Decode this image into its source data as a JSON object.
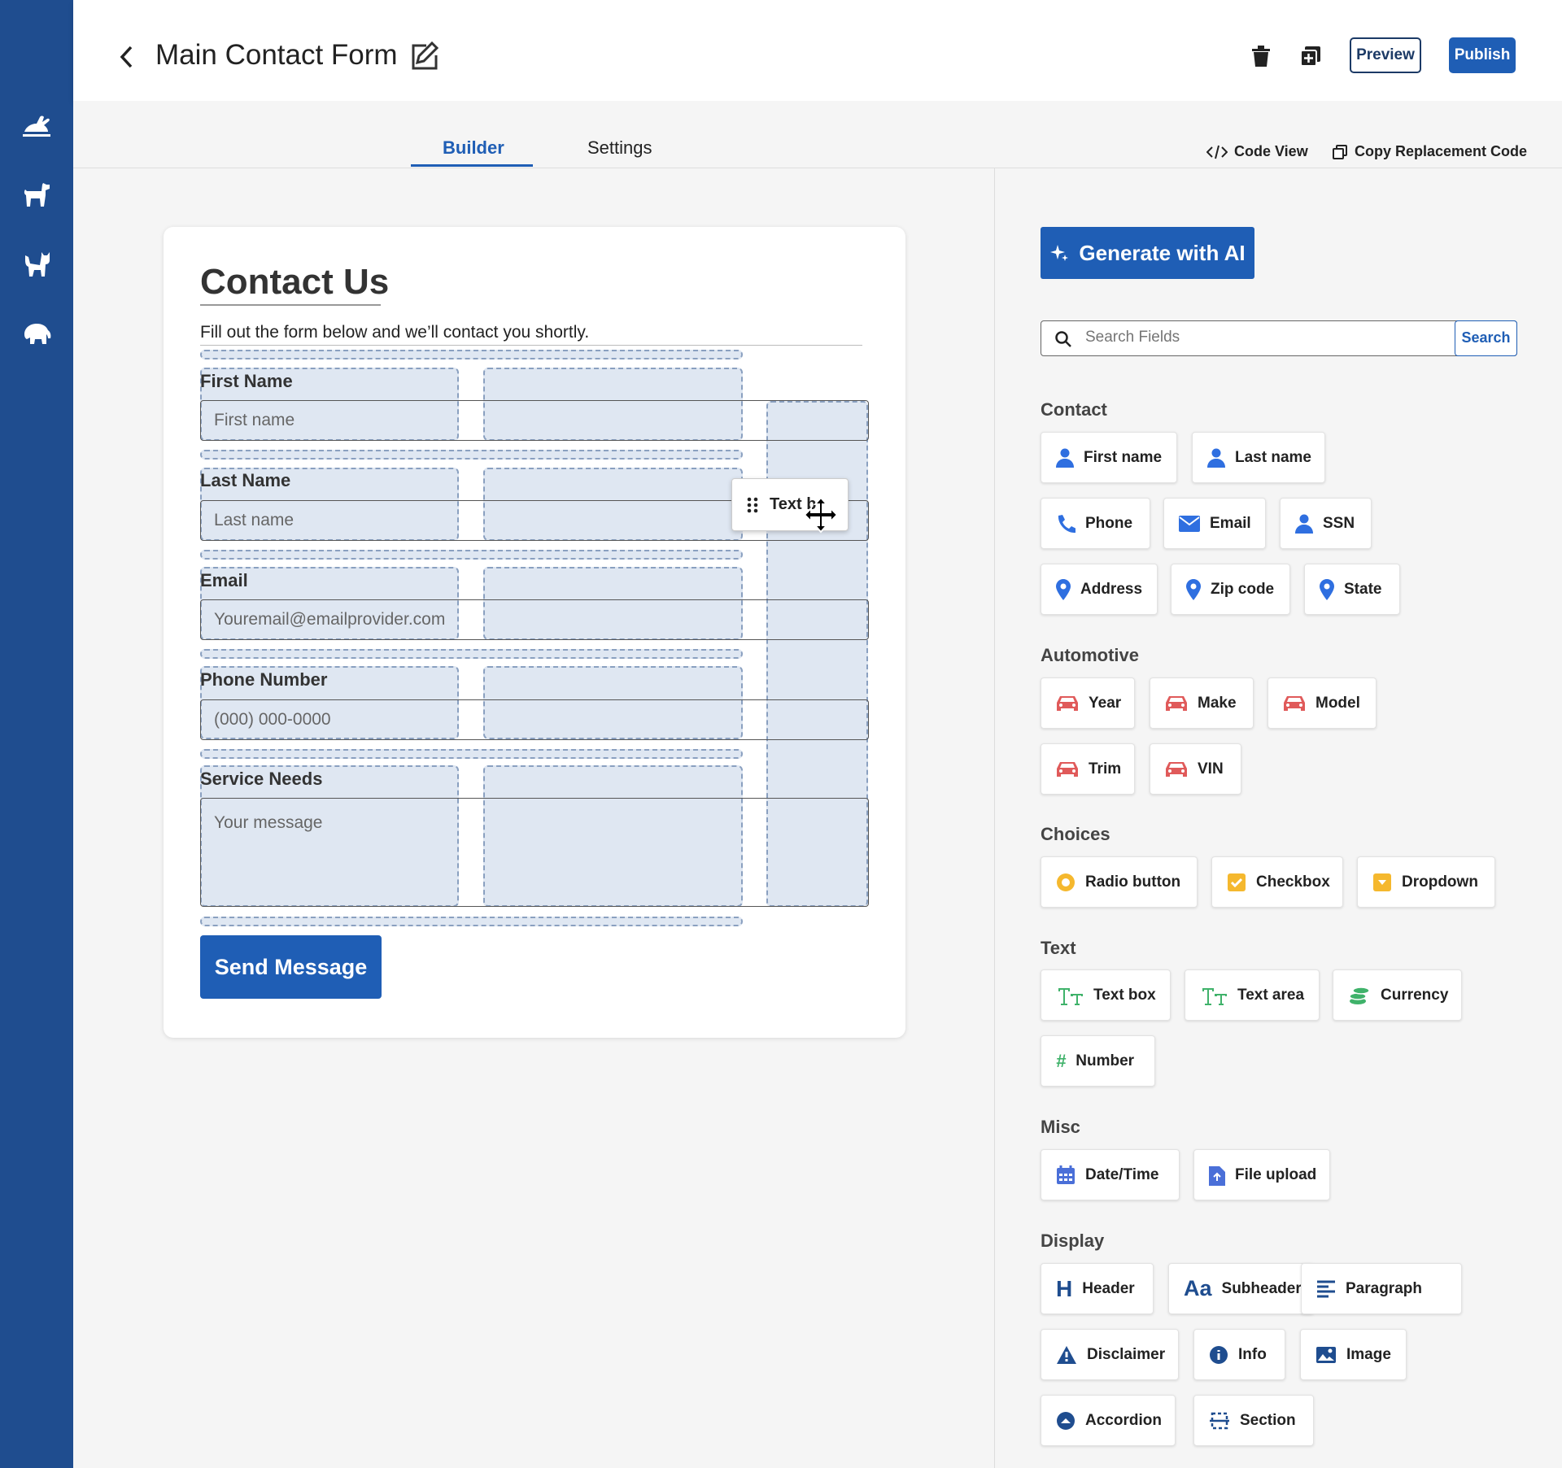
{
  "header": {
    "title": "Main Contact Form",
    "preview_label": "Preview",
    "publish_label": "Publish"
  },
  "tabs": [
    {
      "label": "Builder",
      "active": true
    },
    {
      "label": "Settings",
      "active": false
    }
  ],
  "links": {
    "code_view": "Code View",
    "copy_code": "Copy Replacement Code"
  },
  "sidebar": {
    "icons": [
      "rabbit-icon",
      "dog-icon",
      "cat-icon",
      "elephant-icon"
    ]
  },
  "form": {
    "title": "Contact Us",
    "subtitle": "Fill out the form below and we’ll contact you shortly.",
    "fields": [
      {
        "label": "First Name",
        "placeholder": "First name"
      },
      {
        "label": "Last Name",
        "placeholder": "Last name"
      },
      {
        "label": "Email",
        "placeholder": "Youremail@emailprovider.com"
      },
      {
        "label": "Phone Number",
        "placeholder": "(000) 000-0000"
      },
      {
        "label": "Service Needs",
        "placeholder": "Your message"
      }
    ],
    "submit_label": "Send Message",
    "drag_chip_label": "Text b"
  },
  "panel": {
    "ai_label": "Generate with AI",
    "search_placeholder": "Search Fields",
    "search_button": "Search",
    "categories": {
      "contact": "Contact",
      "automotive": "Automotive",
      "choices": "Choices",
      "text": "Text",
      "misc": "Misc",
      "display": "Display"
    },
    "items": {
      "first_name": "First name",
      "last_name": "Last name",
      "phone": "Phone",
      "email": "Email",
      "ssn": "SSN",
      "address": "Address",
      "zip": "Zip code",
      "state": "State",
      "year": "Year",
      "make": "Make",
      "model": "Model",
      "trim": "Trim",
      "vin": "VIN",
      "radio": "Radio button",
      "checkbox": "Checkbox",
      "dropdown": "Dropdown",
      "textbox": "Text box",
      "textarea": "Text area",
      "currency": "Currency",
      "number": "Number",
      "datetime": "Date/Time",
      "upload": "File upload",
      "header": "Header",
      "subheader": "Subheader",
      "paragraph": "Paragraph",
      "disclaimer": "Disclaimer",
      "info": "Info",
      "image": "Image",
      "accordion": "Accordion",
      "section": "Section"
    }
  },
  "colors": {
    "sidebar": "#1f4d8f",
    "accent": "#1f5eb5",
    "contact_icon": "#2f6fe0",
    "auto_icon": "#e05a5a",
    "choice_icon": "#f5b82e",
    "text_icon": "#3fb26a",
    "misc_icon": "#4a6fd8",
    "display_icon": "#1f4d8f"
  }
}
